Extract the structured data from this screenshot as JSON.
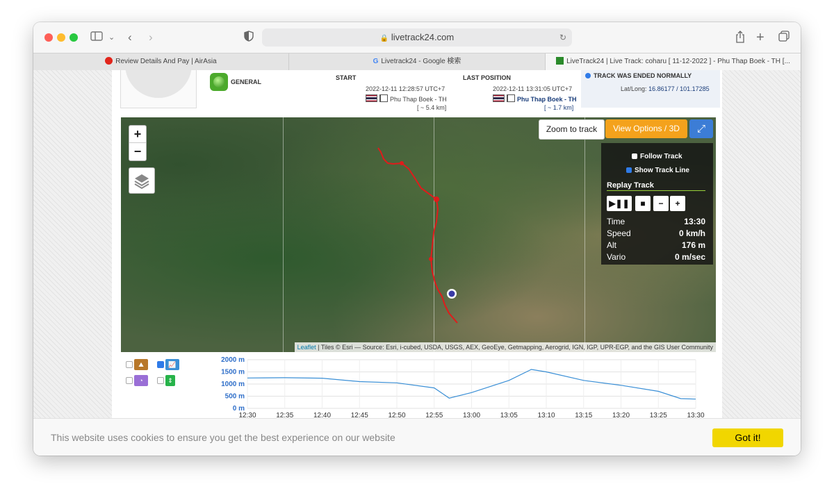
{
  "browser": {
    "url": "livetrack24.com",
    "tabs": [
      {
        "label": "Review Details And Pay | AirAsia"
      },
      {
        "label": "Livetrack24 - Google 検索"
      },
      {
        "label": "LiveTrack24 | Live Track: coharu [ 11-12-2022 ] - Phu Thap Boek - TH [..."
      }
    ]
  },
  "header": {
    "general_label": "GENERAL",
    "start": {
      "label": "START",
      "datetime": "2022-12-11 12:28:57 UTC+7",
      "location": "Phu Thap Boek - TH",
      "distance": "[ ~ 5.4 km]"
    },
    "last": {
      "label": "LAST POSITION",
      "datetime": "2022-12-11 13:31:05 UTC+7",
      "location": "Phu Thap Boek - TH",
      "distance": "[ ~ 1.7 km]"
    },
    "status": {
      "label": "TRACK WAS ENDED NORMALLY",
      "latlong_label": "Lat/Long:",
      "latlong_value": "16.86177 / 101.17285"
    }
  },
  "map": {
    "zoom_in": "+",
    "zoom_out": "−",
    "zoom_to_track": "Zoom to track",
    "view_options": "View Options / 3D",
    "attribution_link": "Leaflet",
    "attribution_text": " | Tiles © Esri — Source: Esri, i-cubed, USDA, USGS, AEX, GeoEye, Getmapping, Aerogrid, IGN, IGP, UPR-EGP, and the GIS User Community",
    "panel": {
      "follow_track": "Follow Track",
      "show_track_line": "Show Track Line",
      "replay_track": "Replay Track",
      "stats": [
        {
          "label": "Time",
          "value": "13:30"
        },
        {
          "label": "Speed",
          "value": "0 km/h"
        },
        {
          "label": "Alt",
          "value": "176 m"
        },
        {
          "label": "Vario",
          "value": "0 m/sec"
        }
      ]
    },
    "colors": {
      "track": "#e01b1b",
      "marker": "#3a3aa6"
    }
  },
  "chart_data": {
    "type": "line",
    "x": [
      "12:28",
      "12:30",
      "12:35",
      "12:40",
      "12:45",
      "12:50",
      "12:55",
      "12:57",
      "13:00",
      "13:05",
      "13:08",
      "13:10",
      "13:15",
      "13:20",
      "13:25",
      "13:28",
      "13:31"
    ],
    "values": [
      1250,
      1250,
      1260,
      1240,
      1100,
      1050,
      840,
      420,
      650,
      1150,
      1600,
      1500,
      1150,
      950,
      700,
      400,
      380
    ],
    "xticks": [
      "12:30",
      "12:35",
      "12:40",
      "12:45",
      "12:50",
      "12:55",
      "13:00",
      "13:05",
      "13:10",
      "13:15",
      "13:20",
      "13:25",
      "13:30"
    ],
    "yticks": [
      "2000 m",
      "1500 m",
      "1000 m",
      "500 m",
      "0 m"
    ],
    "ylim": [
      0,
      2000
    ],
    "grid": true,
    "color": "#3a8fd6"
  },
  "cookie": {
    "text": "This website uses cookies to ensure you get the best experience on our website",
    "button": "Got it!"
  }
}
